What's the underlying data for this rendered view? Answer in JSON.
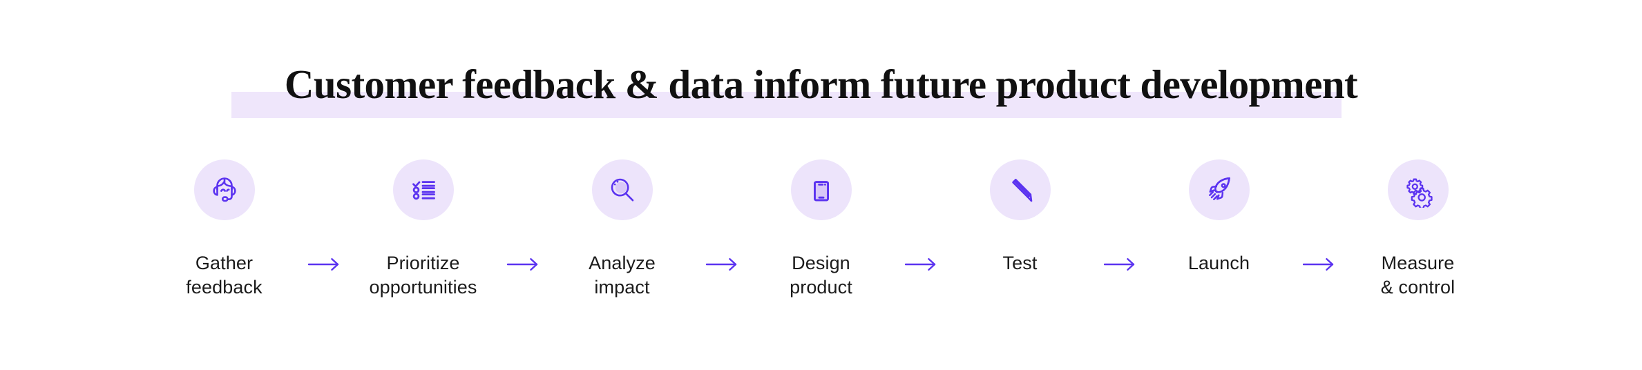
{
  "headline": {
    "text": "Customer feedback & data inform future product development",
    "highlight_color": "#EFE6FB",
    "text_color": "#111111"
  },
  "theme": {
    "accent": "#5B33F0",
    "badge_background": "#EDE4FB",
    "icon_fill": "#D9C8F7",
    "background": "#FFFFFF"
  },
  "flow": {
    "arrow_icon": "arrow-right-icon",
    "steps": [
      {
        "label": "Gather\nfeedback",
        "icon": "headset-support-icon"
      },
      {
        "label": "Prioritize\nopportunities",
        "icon": "checklist-icon"
      },
      {
        "label": "Analyze\nimpact",
        "icon": "magnifier-icon"
      },
      {
        "label": "Design\nproduct",
        "icon": "smartphone-icon"
      },
      {
        "label": "Test",
        "icon": "pencil-icon"
      },
      {
        "label": "Launch",
        "icon": "rocket-icon"
      },
      {
        "label": "Measure\n& control",
        "icon": "gears-icon"
      }
    ]
  }
}
